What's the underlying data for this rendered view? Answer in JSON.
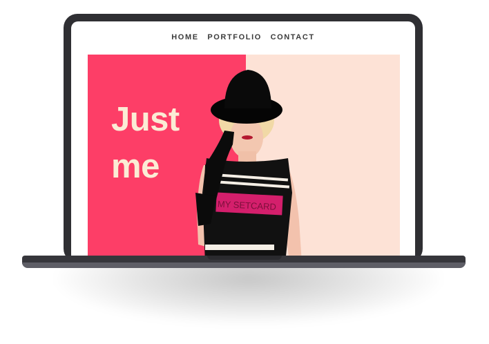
{
  "nav": {
    "items": [
      "HOME",
      "PORTFOLIO",
      "CONTACT"
    ]
  },
  "hero": {
    "title_line1": "Just",
    "title_line2": "me",
    "shirt_text": "MY SETCARD"
  },
  "colors": {
    "accent": "#fd3e67",
    "peach": "#fde2d6",
    "title": "#fbecd5",
    "frame": "#2f2f33"
  }
}
